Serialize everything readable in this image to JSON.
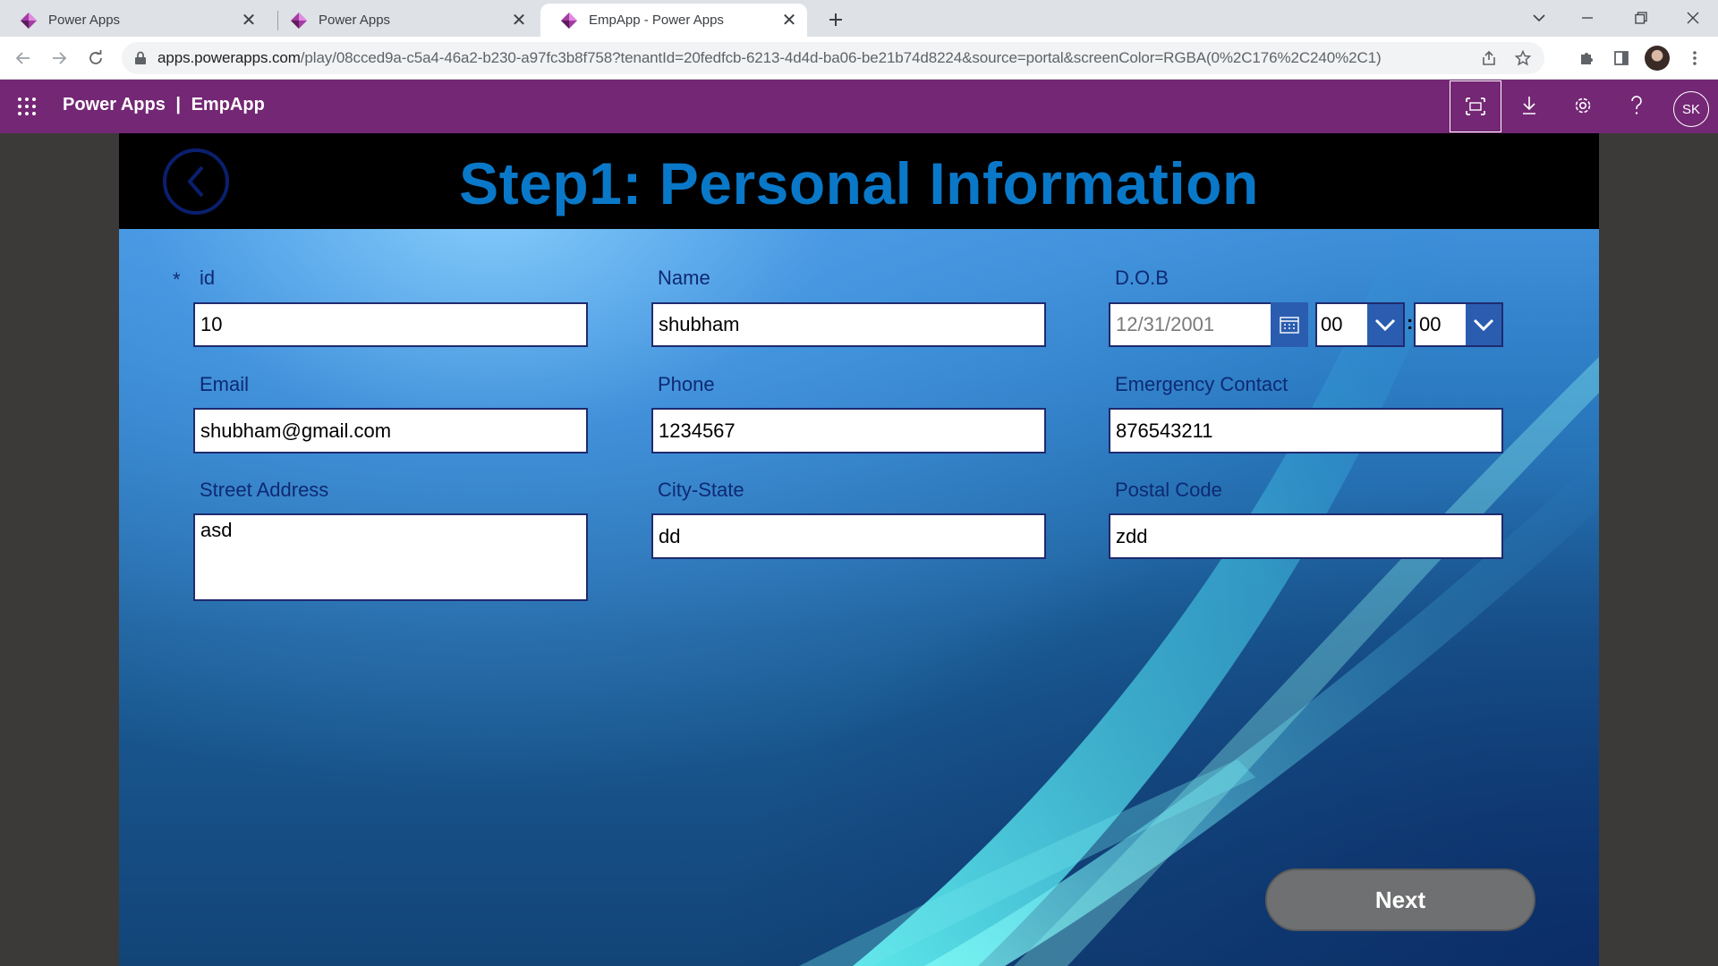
{
  "browser": {
    "tabs": [
      {
        "title": "Power Apps",
        "active": false
      },
      {
        "title": "Power Apps",
        "active": false
      },
      {
        "title": "EmpApp - Power Apps",
        "active": true
      }
    ],
    "url_host": "apps.powerapps.com",
    "url_path": "/play/08cced9a-c5a4-46a2-b230-a97fc3b8f758?tenantId=20fedfcb-6213-4d4d-ba06-be21b74d8224&source=portal&screenColor=RGBA(0%2C176%2C240%2C1)"
  },
  "header": {
    "product": "Power Apps",
    "separator": "|",
    "app_name": "EmpApp",
    "user_initials": "SK",
    "color": "#742774"
  },
  "screen": {
    "title": "Step1: Personal Information",
    "fields": {
      "id": {
        "label": "id",
        "value": "10",
        "required_mark": "*"
      },
      "name": {
        "label": "Name",
        "value": "shubham"
      },
      "dob": {
        "label": "D.O.B",
        "date": "12/31/2001",
        "hour": "00",
        "minute": "00",
        "colon": ":"
      },
      "email": {
        "label": "Email",
        "value": "shubham@gmail.com"
      },
      "phone": {
        "label": "Phone",
        "value": "1234567"
      },
      "emergency": {
        "label": "Emergency Contact",
        "value": "876543211"
      },
      "street": {
        "label": "Street Address",
        "value": "asd"
      },
      "city": {
        "label": "City-State",
        "value": "dd"
      },
      "postal": {
        "label": "Postal Code",
        "value": "zdd"
      }
    },
    "next_label": "Next"
  }
}
